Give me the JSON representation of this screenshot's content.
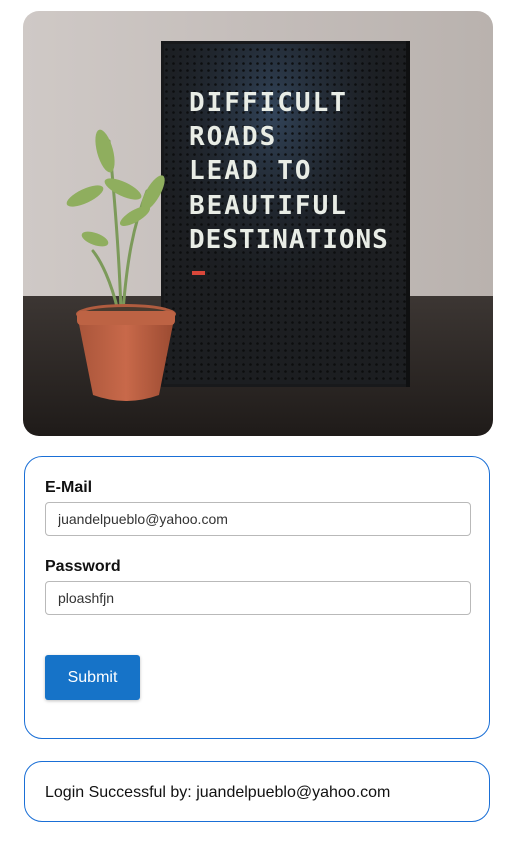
{
  "hero": {
    "alt": "Letter board with a potted plant",
    "board_lines": [
      "DIFFICULT",
      "ROADS",
      "LEAD TO",
      "BEAUTIFUL",
      "DESTINATIONS"
    ]
  },
  "form": {
    "email_label": "E-Mail",
    "email_value": "juandelpueblo@yahoo.com",
    "password_label": "Password",
    "password_value": "ploashfjn",
    "submit_label": "Submit"
  },
  "result": {
    "prefix": "Login Successful by: ",
    "email": "juandelpueblo@yahoo.com"
  },
  "colors": {
    "accent": "#1673c8",
    "card_border": "#1a6fd6"
  }
}
